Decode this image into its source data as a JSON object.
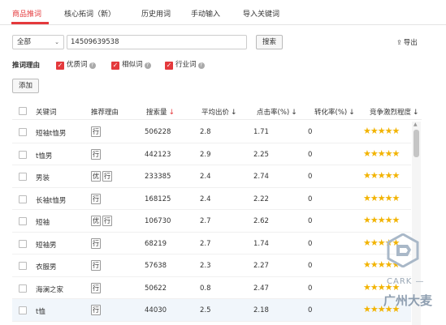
{
  "tabs": [
    {
      "label": "商品推词",
      "active": true
    },
    {
      "label": "核心拓词（新）",
      "active": false
    },
    {
      "label": "历史用词",
      "active": false
    },
    {
      "label": "手动输入",
      "active": false
    },
    {
      "label": "导入关键词",
      "active": false
    }
  ],
  "search": {
    "category_value": "全部",
    "keyword_value": "14509639538",
    "search_button": "搜索",
    "export_label": "导出"
  },
  "reasons": {
    "label": "推词理由",
    "options": [
      {
        "label": "优质词",
        "checked": true
      },
      {
        "label": "相似词",
        "checked": true
      },
      {
        "label": "行业词",
        "checked": true
      }
    ]
  },
  "add_button": "添加",
  "table": {
    "headers": {
      "keyword": "关键词",
      "reason": "推荐理由",
      "search_volume": "搜索量",
      "avg_bid": "平均出价",
      "ctr": "点击率(%)",
      "cvr": "转化率(%)",
      "competition": "竞争激烈程度"
    },
    "rows": [
      {
        "keyword": "短袖t恤男",
        "tags": [
          "行"
        ],
        "search_volume": "506228",
        "avg_bid": "2.8",
        "ctr": "1.71",
        "cvr": "0",
        "stars": 5
      },
      {
        "keyword": "t恤男",
        "tags": [
          "行"
        ],
        "search_volume": "442123",
        "avg_bid": "2.9",
        "ctr": "2.25",
        "cvr": "0",
        "stars": 5
      },
      {
        "keyword": "男装",
        "tags": [
          "优",
          "行"
        ],
        "search_volume": "233385",
        "avg_bid": "2.4",
        "ctr": "2.74",
        "cvr": "0",
        "stars": 5
      },
      {
        "keyword": "长袖t恤男",
        "tags": [
          "行"
        ],
        "search_volume": "168125",
        "avg_bid": "2.4",
        "ctr": "2.22",
        "cvr": "0",
        "stars": 5
      },
      {
        "keyword": "短袖",
        "tags": [
          "优",
          "行"
        ],
        "search_volume": "106730",
        "avg_bid": "2.7",
        "ctr": "2.62",
        "cvr": "0",
        "stars": 5
      },
      {
        "keyword": "短袖男",
        "tags": [
          "行"
        ],
        "search_volume": "68219",
        "avg_bid": "2.7",
        "ctr": "1.74",
        "cvr": "0",
        "stars": 5
      },
      {
        "keyword": "衣服男",
        "tags": [
          "行"
        ],
        "search_volume": "57638",
        "avg_bid": "2.3",
        "ctr": "2.27",
        "cvr": "0",
        "stars": 5
      },
      {
        "keyword": "海澜之家",
        "tags": [
          "行"
        ],
        "search_volume": "50622",
        "avg_bid": "0.8",
        "ctr": "2.47",
        "cvr": "0",
        "stars": 5
      },
      {
        "keyword": "t恤",
        "tags": [
          "行"
        ],
        "search_volume": "44030",
        "avg_bid": "2.5",
        "ctr": "2.18",
        "cvr": "0",
        "stars": 5
      }
    ]
  },
  "watermark": {
    "line1": "CARK —",
    "line2": "广州大麦"
  },
  "colors": {
    "accent": "#e4393c",
    "star": "#f2b300",
    "row_highlight": "#f1f6fb"
  },
  "icons": {
    "export": "export-icon",
    "help": "question-icon",
    "sort": "sort-arrow-icon",
    "star": "star-icon"
  }
}
